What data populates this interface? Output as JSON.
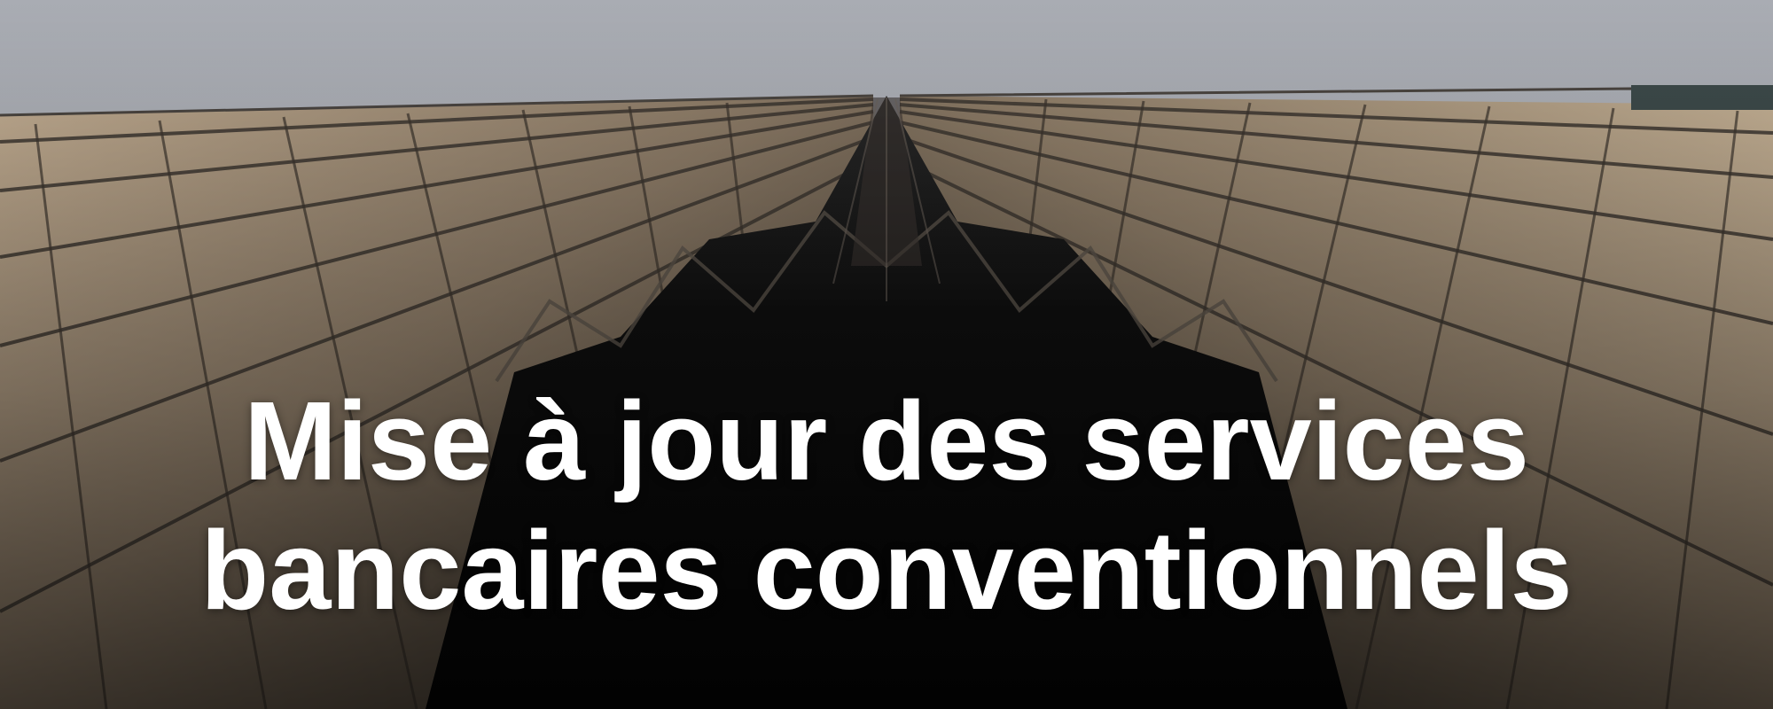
{
  "banner": {
    "headline_line1": "Mise à jour des services",
    "headline_line2": "bancaires conventionnels",
    "background_subject": "skyscraper-glass-facade",
    "colors": {
      "sky": "#b4b7bd",
      "glass_warm": "#b29c82",
      "glass_dark": "#121212",
      "text": "#ffffff"
    }
  }
}
